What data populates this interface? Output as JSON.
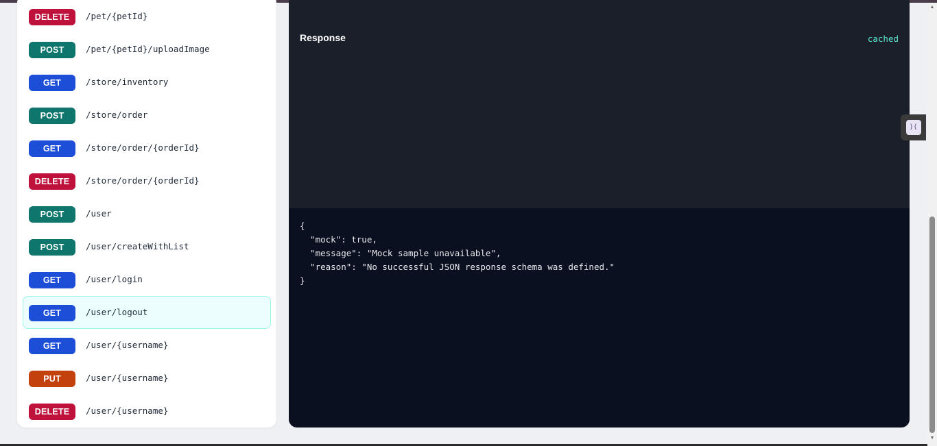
{
  "endpoints": [
    {
      "method": "DELETE",
      "path": "/pet/{petId}",
      "color": "#be123c"
    },
    {
      "method": "POST",
      "path": "/pet/{petId}/uploadImage",
      "color": "#0f766e"
    },
    {
      "method": "GET",
      "path": "/store/inventory",
      "color": "#1d4ed8"
    },
    {
      "method": "POST",
      "path": "/store/order",
      "color": "#0f766e"
    },
    {
      "method": "GET",
      "path": "/store/order/{orderId}",
      "color": "#1d4ed8"
    },
    {
      "method": "DELETE",
      "path": "/store/order/{orderId}",
      "color": "#be123c"
    },
    {
      "method": "POST",
      "path": "/user",
      "color": "#0f766e"
    },
    {
      "method": "POST",
      "path": "/user/createWithList",
      "color": "#0f766e"
    },
    {
      "method": "GET",
      "path": "/user/login",
      "color": "#1d4ed8"
    },
    {
      "method": "GET",
      "path": "/user/logout",
      "color": "#1d4ed8",
      "active": true
    },
    {
      "method": "GET",
      "path": "/user/{username}",
      "color": "#1d4ed8"
    },
    {
      "method": "PUT",
      "path": "/user/{username}",
      "color": "#c2410c"
    },
    {
      "method": "DELETE",
      "path": "/user/{username}",
      "color": "#be123c"
    }
  ],
  "response": {
    "title": "Response",
    "status": "cached",
    "body": "{\n  \"mock\": true,\n  \"message\": \"Mock sample unavailable\",\n  \"reason\": \"No successful JSON response schema was defined.\"\n}"
  },
  "floating_button": {
    "icon": "collapse-icon",
    "glyph": "⟩⟨"
  },
  "colors": {
    "accent": "#5eead4",
    "active_bg": "#ecfefd",
    "active_border": "#99f6e4"
  }
}
